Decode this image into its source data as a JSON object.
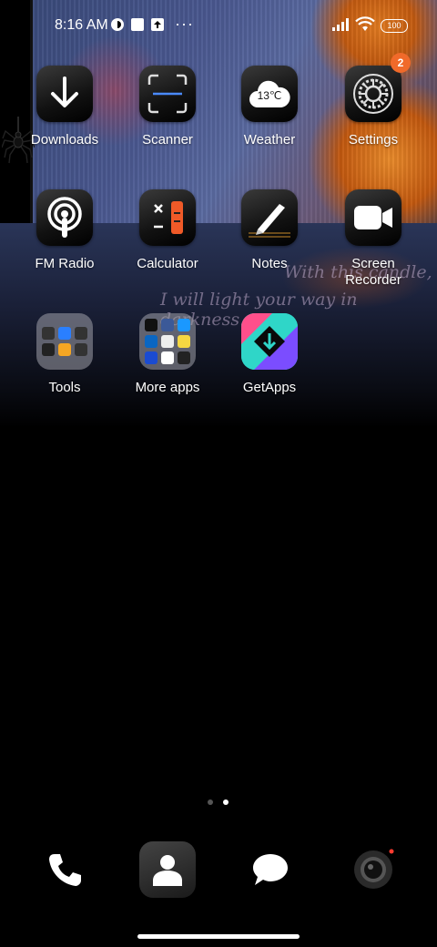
{
  "status_bar": {
    "time": "8:16 AM",
    "icons": [
      "notification-icon",
      "square-icon",
      "upload-icon"
    ],
    "overflow": "···",
    "signal_icon": "signal-icon",
    "wifi_icon": "wifi-icon",
    "battery": "100"
  },
  "wallpaper": {
    "line1": "With this candle,",
    "line2": "I will light your way in darkness."
  },
  "apps": [
    {
      "label": "Downloads",
      "icon": "download-icon"
    },
    {
      "label": "Scanner",
      "icon": "scanner-icon"
    },
    {
      "label": "Weather",
      "icon": "weather-icon",
      "temp": "13℃"
    },
    {
      "label": "Settings",
      "icon": "settings-gear-icon",
      "badge": "2"
    },
    {
      "label": "FM Radio",
      "icon": "radio-icon"
    },
    {
      "label": "Calculator",
      "icon": "calculator-icon"
    },
    {
      "label": "Notes",
      "icon": "pen-icon"
    },
    {
      "label": "Screen\nRecorder",
      "icon": "video-camera-icon"
    },
    {
      "label": "Tools",
      "icon": "folder-icon"
    },
    {
      "label": "More apps",
      "icon": "folder-icon"
    },
    {
      "label": "GetApps",
      "icon": "getapps-icon"
    }
  ],
  "page_indicator": {
    "pages": 2,
    "current": 2
  },
  "dock": [
    {
      "name": "phone",
      "icon": "phone-icon"
    },
    {
      "name": "contacts",
      "icon": "contacts-icon"
    },
    {
      "name": "messages",
      "icon": "message-bubble-icon"
    },
    {
      "name": "camera",
      "icon": "camera-icon"
    }
  ],
  "colors": {
    "badge": "#f06a2a",
    "calculator_accent": "#f05a28",
    "getapps_cyan": "#2fd6c8",
    "getapps_purple": "#7b4dff",
    "getapps_pink": "#ff4f8b"
  }
}
